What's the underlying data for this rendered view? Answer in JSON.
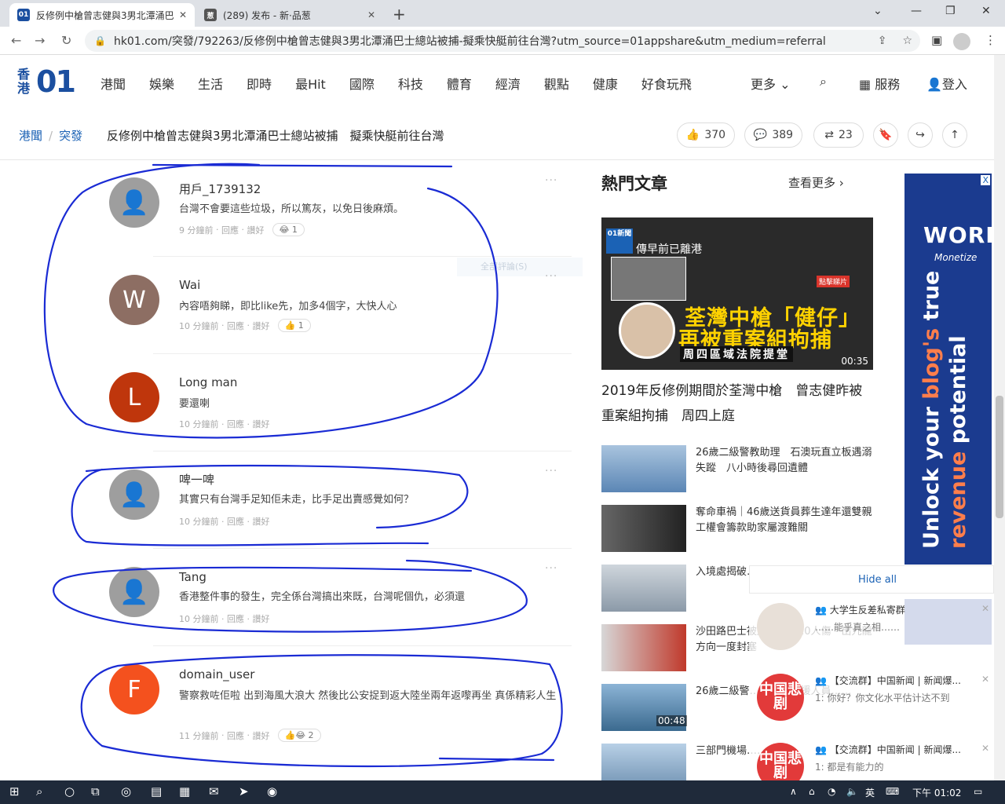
{
  "browser": {
    "tabs": [
      {
        "title": "反修例中槍曾志健與3男北潭涌巴士總站被捕",
        "active": true
      },
      {
        "title": "(289) 发布 - 新·品葱",
        "active": false
      }
    ],
    "url": "hk01.com/突發/792263/反修例中槍曾志健與3男北潭涌巴士總站被捕-擬乘快艇前往台灣?utm_source=01appshare&utm_medium=referral"
  },
  "site": {
    "logo_text": "香港",
    "logo_mark": "01",
    "nav": [
      "港聞",
      "娛樂",
      "生活",
      "即時",
      "最Hit",
      "國際",
      "科技",
      "體育",
      "經濟",
      "觀點",
      "健康",
      "好食玩飛"
    ],
    "more": "更多",
    "services": "服務",
    "login": "登入"
  },
  "article": {
    "breadcrumb": [
      "港聞",
      "突發"
    ],
    "headline": "反修例中槍曾志健與3男北潭涌巴士總站被捕　擬乘快艇前往台灣",
    "likes": "370",
    "comments": "389",
    "shares": "23"
  },
  "comments": [
    {
      "user": "用戶_1739132",
      "text": "台灣不會要這些垃圾，所以篤灰，以免日後麻煩。",
      "time": "9 分鐘前",
      "reply": "回應",
      "like": "讚好",
      "reaction": "😂 1",
      "avatar": "",
      "color": "#9e9e9e"
    },
    {
      "user": "Wai",
      "text": "內容唔夠睇，即比like先，加多4個字，大快人心",
      "time": "10 分鐘前",
      "reply": "回應",
      "like": "讚好",
      "reaction": "👍 1",
      "avatar": "W",
      "color": "#8d6e63"
    },
    {
      "user": "Long man",
      "text": "要還喇",
      "time": "10 分鐘前",
      "reply": "回應",
      "like": "讚好",
      "reaction": "",
      "avatar": "L",
      "color": "#bf360c"
    },
    {
      "user": "啤一啤",
      "text": "其實只有台灣手足知佢未走，比手足出賣感覺如何？",
      "time": "10 分鐘前",
      "reply": "回應",
      "like": "讚好",
      "reaction": "",
      "avatar": "",
      "color": "#9e9e9e"
    },
    {
      "user": "Tang",
      "text": "香港整件事的發生，完全係台灣搞出來既，台灣呢個仇，必須還",
      "time": "10 分鐘前",
      "reply": "回應",
      "like": "讚好",
      "reaction": "",
      "avatar": "",
      "color": "#9e9e9e"
    },
    {
      "user": "domain_user",
      "text": "警察救咗佢啦 出到海風大浪大 然後比公安捉到返大陸坐兩年返嚟再坐 真係精彩人生",
      "time": "11 分鐘前",
      "reply": "回應",
      "like": "讚好",
      "reaction": "👍😂 2",
      "avatar": "F",
      "color": "#f4511e"
    }
  ],
  "faint_text": "全部評論(S)",
  "sidebar": {
    "title": "熱門文章",
    "more": "查看更多",
    "hero": {
      "badge": "01新聞",
      "caption_small": "傳早前已離港",
      "line1": "荃灣中槍「健仔」",
      "line2": "再被重案組拘捕",
      "line3": "周四區域法院提堂",
      "click": "點擊睇片",
      "duration": "00:35",
      "title": "2019年反修例期間於荃灣中槍　曾志健昨被重案組拘捕　周四上庭"
    },
    "articles": [
      {
        "title": "26歲二級警教助理　石澳玩直立板遇溺失蹤　八小時後尋回遺體",
        "duration": ""
      },
      {
        "title": "奪命車禍｜46歲送貨員葬生達年還雙親　工權會籌款助家屬渡難關",
        "duration": ""
      },
      {
        "title": "入境處揭破……150宗案涉……",
        "duration": ""
      },
      {
        "title": "沙田路巴士被迫相撞釀10人傷　出九龍方向一度封塞",
        "duration": ""
      },
      {
        "title": "26歲二級警……跡　救援人員……",
        "duration": "00:48"
      },
      {
        "title": "三部門機場……",
        "duration": ""
      }
    ]
  },
  "ad": {
    "brand": "WORD",
    "sub": "Monetize",
    "tag1": "Unlock your ",
    "tag2": "blog's",
    "tag3": " true",
    "tag4": "revenue",
    "tag5": " potential",
    "close": "X"
  },
  "notifications": {
    "hide_all": "Hide all",
    "items": [
      {
        "title": "大学生反差私寄群",
        "body": "……能乎真之相……",
        "avatar": ""
      },
      {
        "title": "【交流群】中国新闻 | 新闻爆...",
        "body": "1: 你好？你文化水平估计达不到",
        "avatar": "中国悲剧"
      },
      {
        "title": "【交流群】中国新闻 | 新闻爆...",
        "body": "1: 都是有能力的",
        "avatar": "中国悲剧"
      }
    ]
  },
  "taskbar": {
    "ime": "英",
    "time": "下午 01:02"
  }
}
